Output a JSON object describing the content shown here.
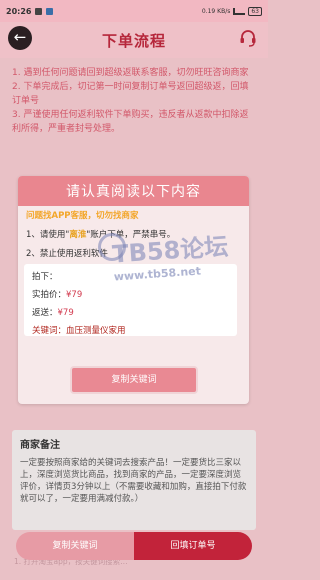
{
  "status": {
    "time": "20:26",
    "net": "0.19 KB/s",
    "battery": "63"
  },
  "header": {
    "title": "下单流程"
  },
  "steps": [
    "1. 遇到任何问题请回到超级返联系客服，切勿旺旺咨询商家",
    "2. 下单完成后，切记第一时间复制订单号返回超级返，回填 订单号",
    "3. 严谨使用任何返利软件下单购买，违反者从返款中扣除返 利所得，严重者封号处理。"
  ],
  "card": {
    "title": "请认真阅读以下内容",
    "warning": "问题找APP客服，切勿找商家",
    "rule1_prefix": "1、请使用\"",
    "rule1_highlight": "离淮",
    "rule1_suffix": "\"账户下单，严禁串号。",
    "rule2": "2、禁止使用返利软件",
    "price_label": "拍下：",
    "price_value": "",
    "paid_label": "实拍价：",
    "paid_value": "¥79",
    "refund_label": "返送：",
    "refund_value": "¥79",
    "keyword_label": "关键词：",
    "keyword_value": "血压测量仪家用",
    "copy_button": "复制关键词"
  },
  "watermark": {
    "text": "TB58论坛",
    "url": "www.tb58.net"
  },
  "note": {
    "title": "商家备注",
    "text": "一定要按照商家给的关键词去搜索产品！一定要货比三家以上，深度浏览货比商品，找到商家的产品，一定要深度浏览评价，详情页3分钟以上（不需要收藏和加购，直接拍下付款就可以了，一定要用满减付款。）"
  },
  "faded_text": "1. 打开淘宝app，按关键词搜索…",
  "bottom": {
    "copy_label": "复制关键词",
    "submit_label": "回填订单号"
  }
}
